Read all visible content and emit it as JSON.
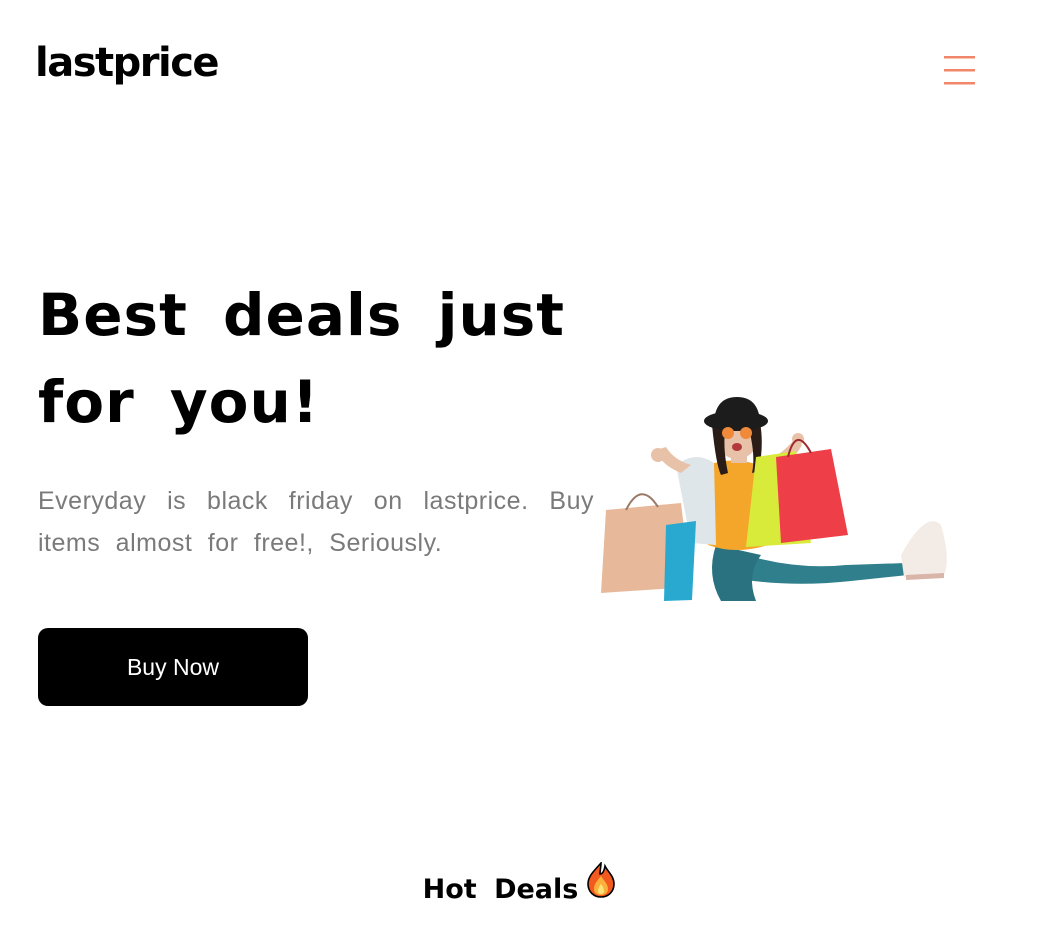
{
  "header": {
    "logo_text": "lastprice",
    "menu_icon": "hamburger-menu-icon",
    "accent_color": "#F0876A"
  },
  "hero": {
    "title": "Best deals just for you!",
    "subtitle": "Everyday is black friday on lastprice. Buy items almost for free!, Seriously.",
    "cta_label": "Buy Now",
    "image_subject": "woman-with-shopping-bags"
  },
  "section": {
    "title": "Hot Deals",
    "icon": "fire-icon"
  }
}
